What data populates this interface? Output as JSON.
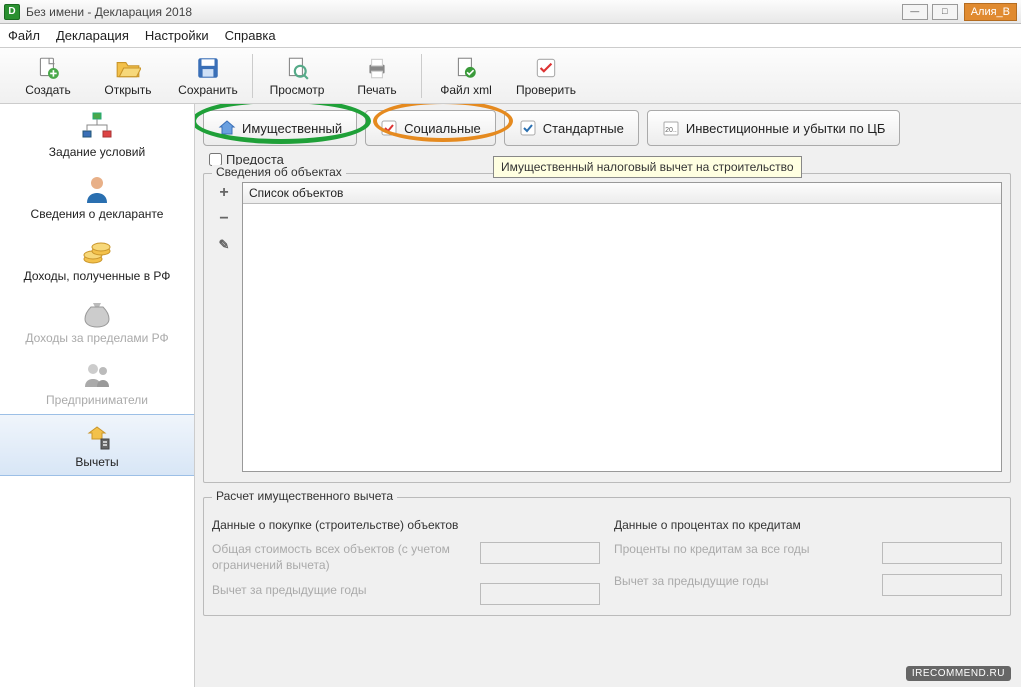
{
  "titlebar": {
    "title": "Без имени - Декларация 2018",
    "user_badge": "Алия_В"
  },
  "menu": {
    "file": "Файл",
    "declaration": "Декларация",
    "settings": "Настройки",
    "help": "Справка"
  },
  "toolbar": {
    "create": "Создать",
    "open": "Открыть",
    "save": "Сохранить",
    "preview": "Просмотр",
    "print": "Печать",
    "file_xml": "Файл xml",
    "check": "Проверить"
  },
  "sidebar": {
    "conditions": "Задание условий",
    "declarant": "Сведения о декларанте",
    "income_rf": "Доходы, полученные в РФ",
    "income_abroad": "Доходы за пределами РФ",
    "entrepreneurs": "Предприниматели",
    "deductions": "Вычеты"
  },
  "tabs": {
    "property": "Имущественный",
    "social": "Социальные",
    "standard": "Стандартные",
    "investment": "Инвестиционные и убытки по ЦБ"
  },
  "checkbox": {
    "provide_label": "Предоста"
  },
  "tooltip": {
    "property_tip": "Имущественный налоговый вычет на строительство"
  },
  "objects_group": {
    "legend": "Сведения об объектах",
    "list_header": "Список объектов"
  },
  "calc_group": {
    "legend": "Расчет имущественного вычета",
    "left_legend": "Данные о покупке (строительстве) объектов",
    "right_legend": "Данные о процентах по кредитам",
    "total_cost_label": "Общая стоимость всех объектов (с учетом ограничений вычета)",
    "prev_deduction_label": "Вычет за предыдущие годы",
    "interest_label": "Проценты по кредитам за все годы",
    "prev_deduction_label_r": "Вычет за предыдущие годы"
  },
  "watermark": "IRECOMMEND.RU"
}
